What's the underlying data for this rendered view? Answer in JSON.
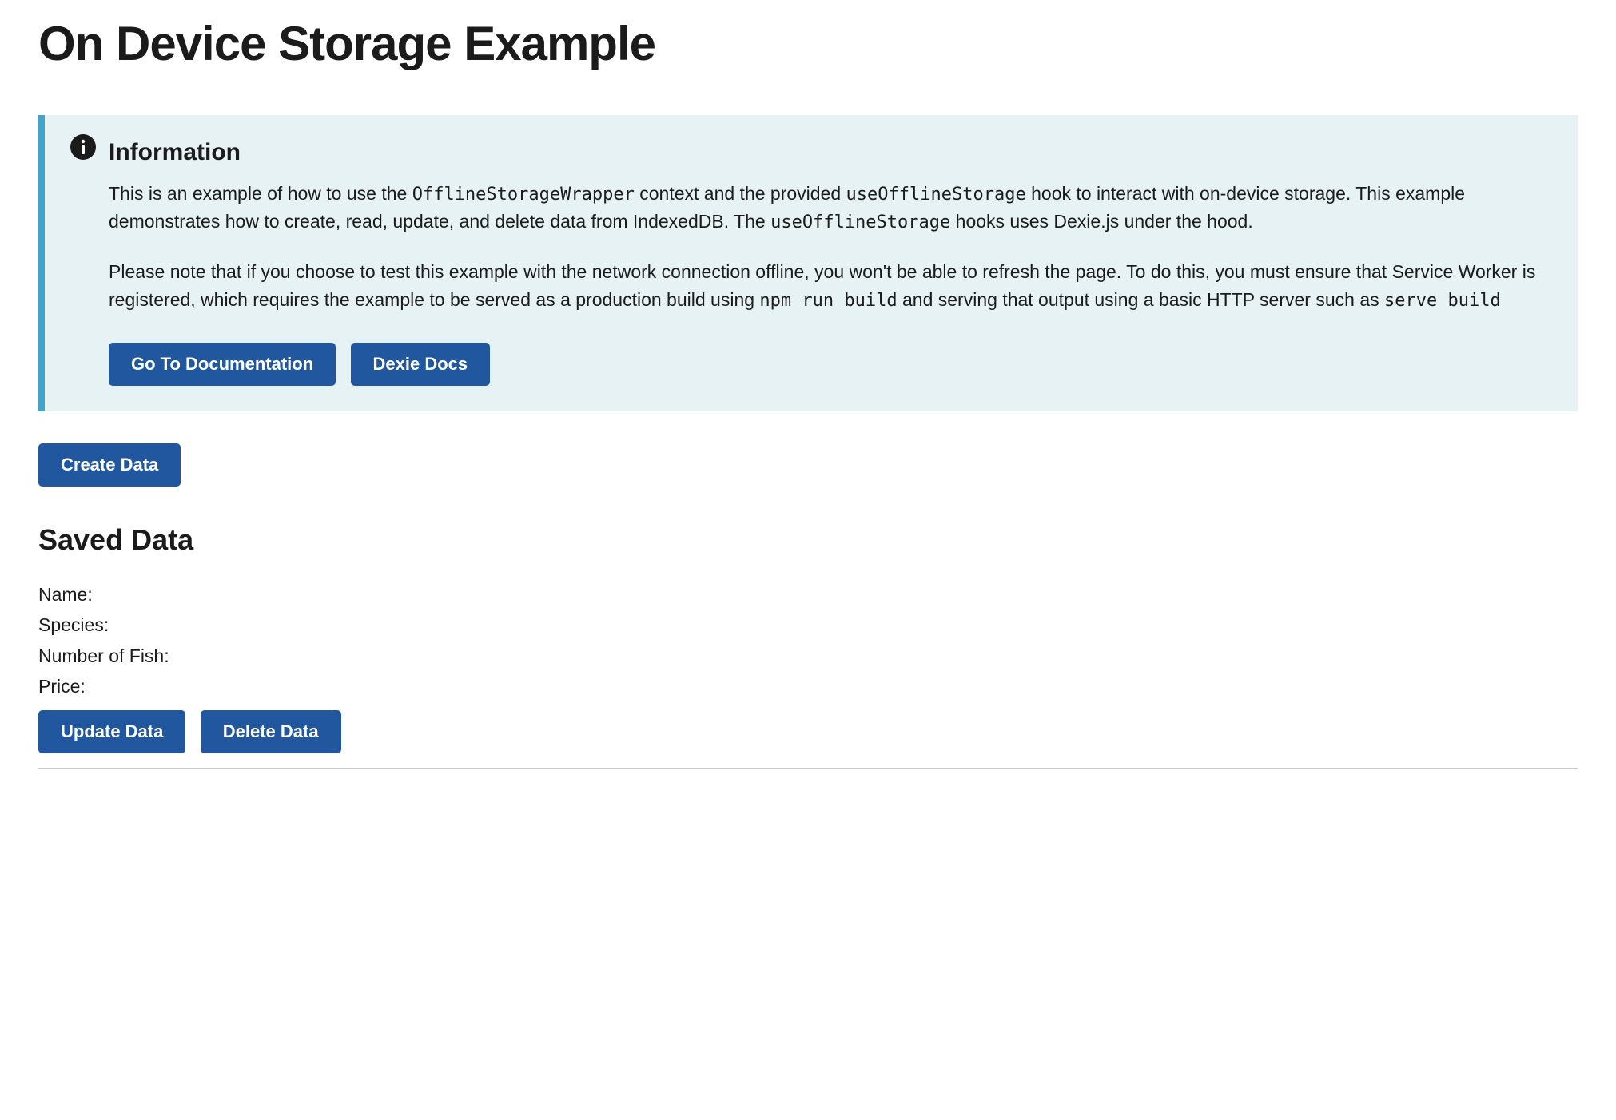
{
  "page": {
    "title": "On Device Storage Example"
  },
  "alert": {
    "heading": "Information",
    "para1_a": "This is an example of how to use the ",
    "code1": "OfflineStorageWrapper",
    "para1_b": " context and the provided ",
    "code2": "useOfflineStorage",
    "para1_c": " hook to interact with on-device storage. This example demonstrates how to create, read, update, and delete data from IndexedDB. The ",
    "code3": "useOfflineStorage",
    "para1_d": " hooks uses Dexie.js under the hood.",
    "para2_a": "Please note that if you choose to test this example with the network connection offline, you won't be able to refresh the page. To do this, you must ensure that Service Worker is registered, which requires the example to be served as a production build using ",
    "code4": "npm run build",
    "para2_b": " and serving that output using a basic HTTP server such as ",
    "code5": "serve build",
    "buttons": {
      "docs": "Go To Documentation",
      "dexie": "Dexie Docs"
    }
  },
  "actions": {
    "create": "Create Data",
    "update": "Update Data",
    "delete": "Delete Data"
  },
  "saved": {
    "heading": "Saved Data",
    "fields": {
      "name_label": "Name:",
      "name_value": "",
      "species_label": "Species:",
      "species_value": "",
      "count_label": "Number of Fish:",
      "count_value": "",
      "price_label": "Price:",
      "price_value": ""
    }
  }
}
